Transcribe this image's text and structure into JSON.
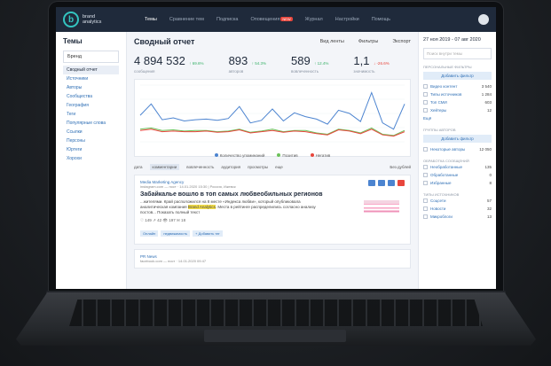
{
  "nav": {
    "logo_text": "brand analytics",
    "items": [
      "Темы",
      "Сравнение тем",
      "Подписка",
      "Оповещения",
      "Журнал",
      "Настройки",
      "Помощь"
    ],
    "badge": "NEW"
  },
  "left": {
    "title": "Темы",
    "select": "Бренд",
    "items": [
      "Сводный отчет",
      "Источники",
      "Авторы",
      "Сообщества",
      "География",
      "Теги",
      "Популярные слова",
      "Ссылки",
      "Персоны",
      "Юртеги",
      "Хорохи"
    ]
  },
  "main": {
    "title": "Сводный отчет",
    "view": "Вид ленты",
    "filters": "Фильтры",
    "export": "Экспорт",
    "stats": [
      {
        "num": "4 894 532",
        "delta": "↑ 69.6%",
        "lbl": "сообщения",
        "dir": "up"
      },
      {
        "num": "893",
        "delta": "↑ 54.3%",
        "lbl": "авторов",
        "dir": "up"
      },
      {
        "num": "589",
        "delta": "↑ 12.4%",
        "lbl": "вовлеченность",
        "dir": "up"
      },
      {
        "num": "1,1",
        "delta": "↓ -26.6%",
        "lbl": "значимость",
        "dir": "down"
      }
    ],
    "legend": [
      "Количество упоминаний",
      "Позитив",
      "Негатив"
    ],
    "tabs": [
      "дата",
      "комментарии",
      "вовлеченность",
      "аудитория",
      "просмотры",
      "еще"
    ],
    "dup_label": "Без дублей",
    "post1": {
      "src": "Media Marketing Agency",
      "site": "instagram.com — пост · 14.01.2020 15:30 | Россия, Ижевск",
      "title": "Забайкалье вошло в топ самых любвеобильных регионов",
      "body_a": "...жителями. Край расположился на 8 месте «Индекса любви», который опубликовала аналитическая компания ",
      "body_hl": "Brand Analytics",
      "body_b": ". Места в рейтинге распределились согласно анализу постов... Показать полный текст",
      "meta": "♡ 149   ↗ 42   👁 197   ✉ 18",
      "chips": [
        "Онлайн",
        "недвижимость",
        "+ Добавить тег"
      ]
    },
    "post2": {
      "src": "PR News",
      "site": "facebook.com — пост · 14.01.2020 09:47"
    }
  },
  "right": {
    "date": "27 ноя 2019 - 07 авг 2020",
    "search": "Поиск внутри темы",
    "sect1": "Персональные фильтры",
    "add": "Добавить фильтр",
    "f1": [
      [
        "Видео контент",
        "3 540"
      ],
      [
        "Типы источников",
        "1 284"
      ],
      [
        "Топ СМИ",
        "603"
      ],
      [
        "Хейтеры",
        "12"
      ]
    ],
    "more": "Ещё",
    "sect2": "Группы авторов",
    "add2": "Добавить фильтр",
    "f2": [
      [
        "Некоторые авторы",
        "12 050"
      ]
    ],
    "sect3": "Обработка сообщений",
    "f3": [
      [
        "Необработанные",
        "135"
      ],
      [
        "Обработанные",
        "0"
      ],
      [
        "Избранные",
        "8"
      ]
    ],
    "sect4": "Типы источников",
    "f4": [
      [
        "Соцсети",
        "57"
      ],
      [
        "Новости",
        "32"
      ],
      [
        "Микроблоги",
        "13"
      ]
    ]
  },
  "chart_data": {
    "type": "line",
    "series": [
      {
        "name": "Количество упоминаний",
        "color": "#4c84d0",
        "values": [
          42,
          60,
          35,
          38,
          33,
          35,
          36,
          34,
          37,
          56,
          30,
          34,
          52,
          33,
          46,
          40,
          36,
          28,
          50,
          45,
          32,
          78,
          30,
          20,
          60
        ]
      },
      {
        "name": "Позитив",
        "color": "#6cc25a",
        "values": [
          20,
          22,
          18,
          19,
          17,
          18,
          18,
          16,
          17,
          20,
          15,
          17,
          20,
          16,
          18,
          18,
          14,
          12,
          20,
          18,
          14,
          22,
          12,
          10,
          18
        ]
      },
      {
        "name": "Негатив",
        "color": "#e8463c",
        "values": [
          18,
          20,
          16,
          17,
          16,
          16,
          17,
          15,
          16,
          19,
          14,
          16,
          18,
          15,
          17,
          16,
          13,
          11,
          19,
          17,
          13,
          20,
          11,
          9,
          16
        ]
      }
    ],
    "ylim": [
      0,
      90
    ]
  }
}
